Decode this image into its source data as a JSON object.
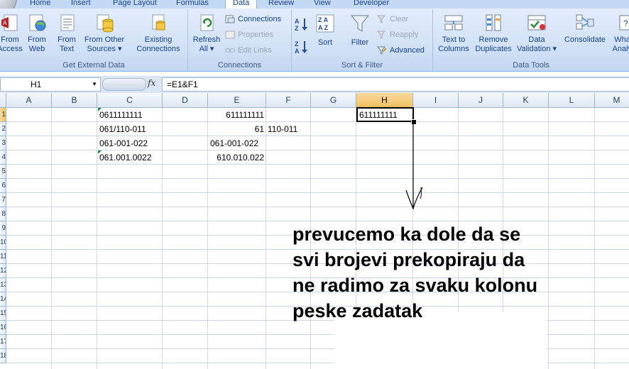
{
  "tabs": [
    {
      "label": "Home",
      "active": false
    },
    {
      "label": "Insert",
      "active": false
    },
    {
      "label": "Page Layout",
      "active": false
    },
    {
      "label": "Formulas",
      "active": false
    },
    {
      "label": "Data",
      "active": true
    },
    {
      "label": "Review",
      "active": false
    },
    {
      "label": "View",
      "active": false
    },
    {
      "label": "Developer",
      "active": false
    }
  ],
  "ribbon": {
    "get_external_data": {
      "label": "Get External Data",
      "from_access": [
        "From",
        "Access"
      ],
      "from_web": [
        "From",
        "Web"
      ],
      "from_text": [
        "From",
        "Text"
      ],
      "from_other_sources": [
        "From Other",
        "Sources ▾"
      ],
      "existing_connections": [
        "Existing",
        "Connections"
      ]
    },
    "connections": {
      "label": "Connections",
      "refresh_all": [
        "Refresh",
        "All ▾"
      ],
      "connections": "Connections",
      "properties": "Properties",
      "edit_links": "Edit Links"
    },
    "sort_filter": {
      "label": "Sort & Filter",
      "sort": "Sort",
      "filter": "Filter",
      "clear": "Clear",
      "reapply": "Reapply",
      "advanced": "Advanced"
    },
    "data_tools": {
      "label": "Data Tools",
      "text_to_columns": [
        "Text to",
        "Columns"
      ],
      "remove_duplicates": [
        "Remove",
        "Duplicates"
      ],
      "data_validation": [
        "Data",
        "Validation ▾"
      ],
      "consolidate": "Consolidate",
      "what_if": [
        "What-If",
        "Analysis"
      ]
    }
  },
  "formula_bar": {
    "name_box": "H1",
    "fx": "fx",
    "formula": "=E1&F1"
  },
  "columns": [
    "A",
    "B",
    "C",
    "D",
    "E",
    "F",
    "G",
    "H",
    "I",
    "J",
    "K",
    "L",
    "M"
  ],
  "selected_column": "H",
  "rows": [
    "1",
    "2",
    "3",
    "4",
    "5",
    "6",
    "7",
    "8",
    "9",
    "10",
    "11",
    "12",
    "13",
    "14",
    "15",
    "16",
    "17",
    "18"
  ],
  "cells": {
    "C1": "0611111111",
    "C2": "061/110-011",
    "C3": "061-001-022",
    "C4": "061.001.0022",
    "E1": "611111111",
    "E2": "61",
    "E3": "061-001-022",
    "E4": "610.010.022",
    "F2": "110-011",
    "H1": "611111111"
  },
  "annotation": {
    "lines": [
      "prevucemo ka dole da se",
      "svi brojevi prekopiraju da",
      "ne radimo za svaku kolonu",
      "peske zadatak"
    ]
  }
}
